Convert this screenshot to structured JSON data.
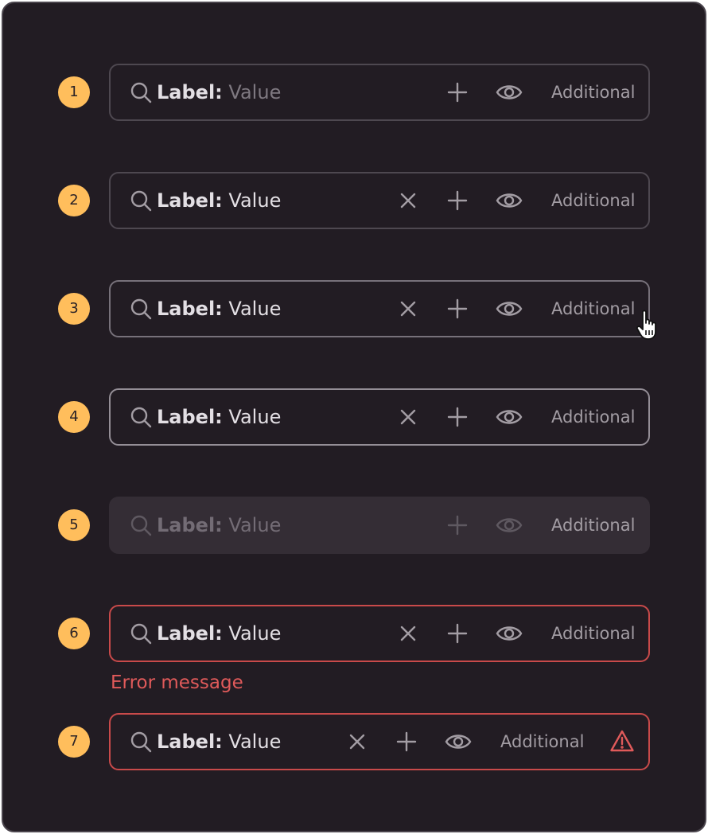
{
  "fields": [
    {
      "number": "1",
      "label": "Label:",
      "value": "Value",
      "additional": "Additional"
    },
    {
      "number": "2",
      "label": "Label:",
      "value": "Value",
      "additional": "Additional"
    },
    {
      "number": "3",
      "label": "Label:",
      "value": "Value",
      "additional": "Additional"
    },
    {
      "number": "4",
      "label": "Label:",
      "value": "Value",
      "additional": "Additional"
    },
    {
      "number": "5",
      "label": "Label:",
      "value": "Value",
      "additional": "Additional"
    },
    {
      "number": "6",
      "label": "Label:",
      "value": "Value",
      "additional": "Additional"
    },
    {
      "number": "7",
      "label": "Label:",
      "value": "Value",
      "additional": "Additional"
    }
  ],
  "error_message": "Error message",
  "icons": {
    "search": "search-icon",
    "clear": "close-icon",
    "add": "plus-icon",
    "view": "eye-icon",
    "warning": "warning-icon",
    "cursor": "hand-cursor-icon"
  },
  "colors": {
    "background": "#221c23",
    "badge": "#ffbe5c",
    "error": "#e05a5a"
  }
}
